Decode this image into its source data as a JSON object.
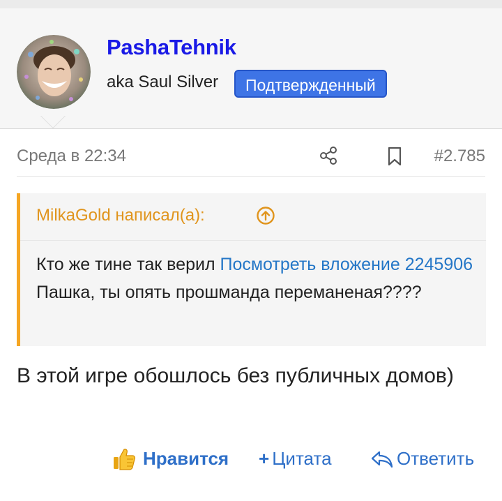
{
  "user": {
    "name": "PashaTehnik",
    "title": "aka Saul Silver",
    "badge": "Подтвержденный"
  },
  "post": {
    "date": "Среда в 22:34",
    "number": "#2.785",
    "text": "В этой игре обошлось без публичных домов)"
  },
  "quote": {
    "author": "MilkaGold написал(а):",
    "text_before": "Кто же тине так верил ",
    "link_text": "Посмотреть вложение 2245906",
    "text_after": " Пашка, ты опять прошманда переманеная????"
  },
  "actions": {
    "like": "Нравится",
    "quote": "Цитата",
    "reply": "Ответить"
  },
  "icons": {
    "share": "share-icon",
    "bookmark": "bookmark-icon",
    "quote_jump": "arrow-up-circle-icon",
    "like": "thumbs-up-icon",
    "reply": "reply-icon"
  },
  "colors": {
    "username": "#1a1ae6",
    "badge": "#3e74e6",
    "link": "#2577c7",
    "quote_accent": "#f5a623",
    "action": "#2e6fc8"
  }
}
